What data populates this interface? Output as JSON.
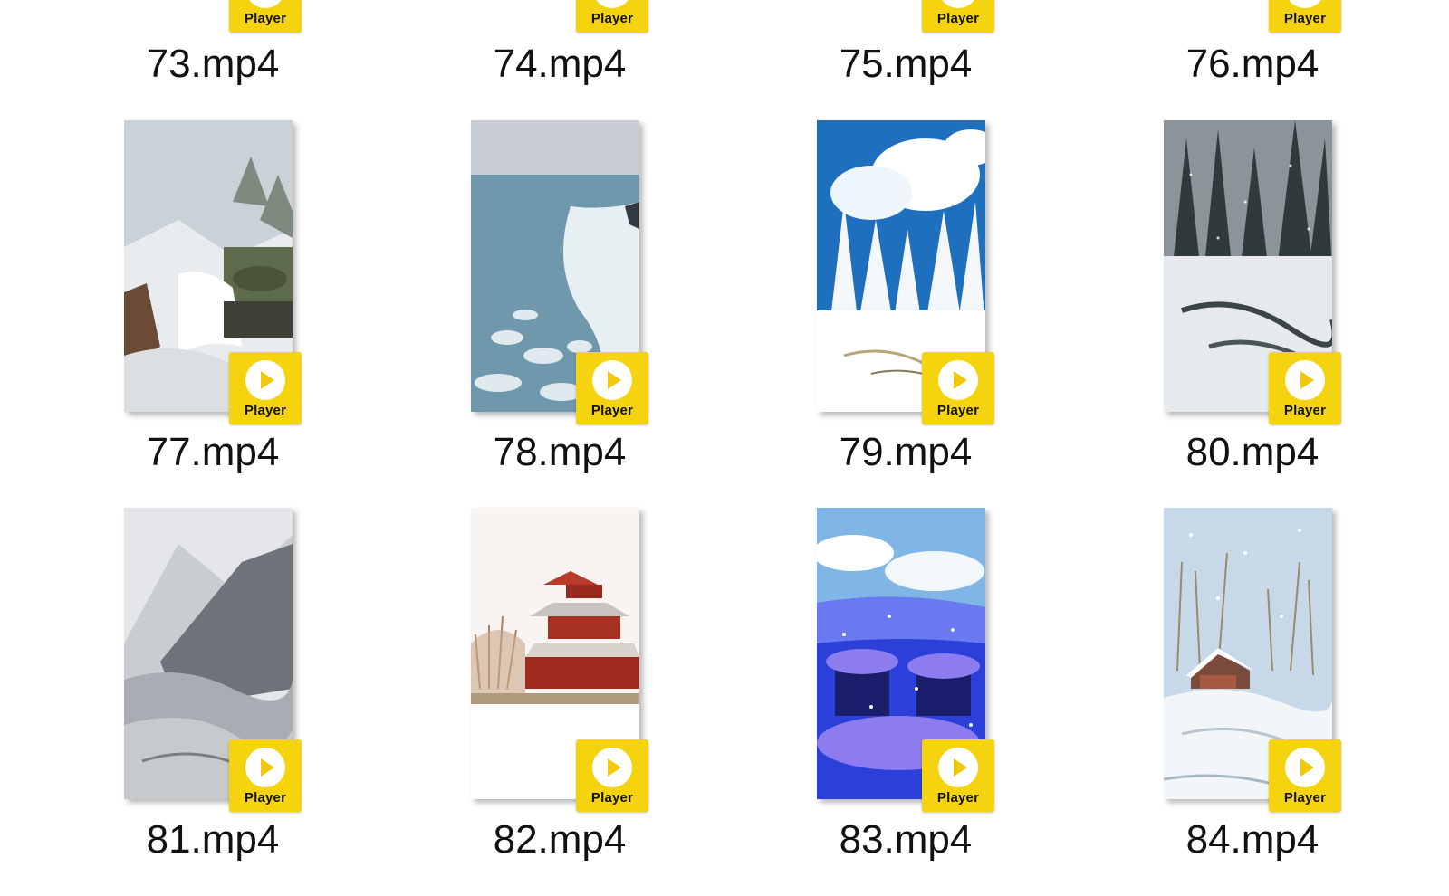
{
  "files": [
    {
      "name": "73.mp4",
      "badge_label": "Player",
      "thumbnail": "snowy-river-teal"
    },
    {
      "name": "74.mp4",
      "badge_label": "Player",
      "thumbnail": "frosted-branches"
    },
    {
      "name": "75.mp4",
      "badge_label": "Player",
      "thumbnail": "night-snow"
    },
    {
      "name": "76.mp4",
      "badge_label": "Player",
      "thumbnail": "snowy-blue-forest"
    },
    {
      "name": "77.mp4",
      "badge_label": "Player",
      "thumbnail": "snowy-stream-forest"
    },
    {
      "name": "78.mp4",
      "badge_label": "Player",
      "thumbnail": "frozen-sea-ice"
    },
    {
      "name": "79.mp4",
      "badge_label": "Player",
      "thumbnail": "snow-trees-blue-sky"
    },
    {
      "name": "80.mp4",
      "badge_label": "Player",
      "thumbnail": "dark-forest-snowfall"
    },
    {
      "name": "81.mp4",
      "badge_label": "Player",
      "thumbnail": "misty-snow-mountains"
    },
    {
      "name": "82.mp4",
      "badge_label": "Player",
      "thumbnail": "snowy-pagoda-tower"
    },
    {
      "name": "83.mp4",
      "badge_label": "Player",
      "thumbnail": "blue-snow-village"
    },
    {
      "name": "84.mp4",
      "badge_label": "Player",
      "thumbnail": "snowy-cabin-birches"
    }
  ],
  "colors": {
    "badge": "#f5d40f",
    "play_triangle": "#f0c90a",
    "text": "#111111",
    "background": "#ffffff"
  }
}
